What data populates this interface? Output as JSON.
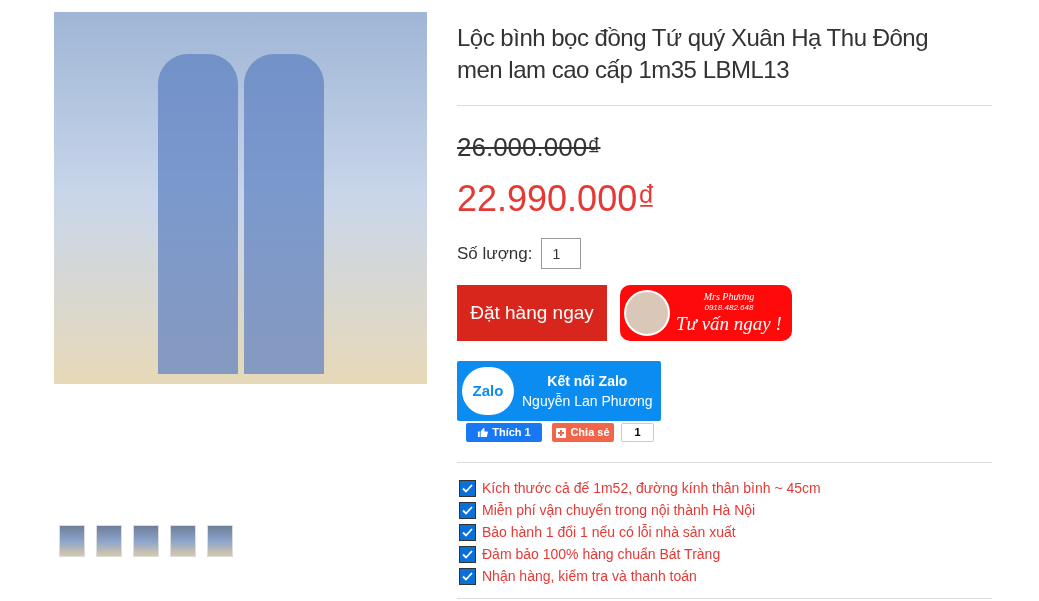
{
  "gallery": {
    "thumbnails": [
      {
        "kind": "photo"
      },
      {
        "kind": "photo"
      },
      {
        "kind": "photo"
      },
      {
        "kind": "photo"
      },
      {
        "kind": "photo"
      }
    ]
  },
  "product": {
    "title": "Lộc bình bọc đồng Tứ quý Xuân Hạ Thu Đông men lam cao cấp 1m35 LBML13",
    "old_price": "26.000.000₫",
    "price": "22.990.000₫"
  },
  "quantity": {
    "label": "Số lượng:",
    "value": "1"
  },
  "order_button": "Đặt hàng ngay",
  "consult_banner": {
    "name": "Mrs Phương",
    "phone": "0918.482.648",
    "label": "Tư vấn ngay !"
  },
  "zalo_banner": {
    "logo": "Zalo",
    "title": "Kết nối Zalo",
    "name": "Nguyễn Lan Phương"
  },
  "social": {
    "like": "Thích 1",
    "share": "Chia sẻ",
    "share_count": "1"
  },
  "features": [
    {
      "text": "Kích thước cả đế 1m52, đường kính thân bình ~ 45cm",
      "checked": true
    },
    {
      "text": "Miễn phí vận chuyển trong nội thành Hà Nội",
      "checked": true
    },
    {
      "text": "Bảo hành 1 đổi 1 nếu có lỗi nhà sản xuất",
      "checked": true
    },
    {
      "text": "Đảm bảo 100% hàng chuẩn Bát Tràng",
      "checked": true
    },
    {
      "text": "Nhận hàng, kiểm tra và thanh toán",
      "checked": true
    }
  ]
}
